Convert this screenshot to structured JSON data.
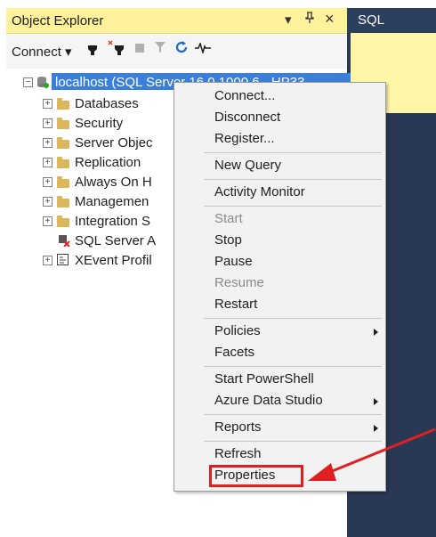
{
  "object_explorer": {
    "title": "Object Explorer",
    "title_buttons": {
      "dropdown": "▾",
      "pin": "ᵖ",
      "close": "×"
    },
    "toolbar": {
      "connect": "Connect ▾"
    },
    "tree": {
      "root": "localhost (SQL Server 16.0.1000.6 - HP33",
      "children": [
        "Databases",
        "Security",
        "Server Objec",
        "Replication",
        "Always On H",
        "Managemen",
        "Integration S",
        "SQL Server A",
        "XEvent Profil"
      ]
    }
  },
  "document_tab": {
    "label": "SQL"
  },
  "context_menu": {
    "items": [
      "Connect...",
      "Disconnect",
      "Register...",
      "New Query",
      "Activity Monitor",
      "Start",
      "Stop",
      "Pause",
      "Resume",
      "Restart",
      "Policies",
      "Facets",
      "Start PowerShell",
      "Azure Data Studio",
      "Reports",
      "Refresh",
      "Properties"
    ]
  },
  "colors": {
    "title_bar": "#fff29d",
    "selection": "#3b7fd9",
    "frame": "#293955",
    "annotation": "#e02020"
  }
}
